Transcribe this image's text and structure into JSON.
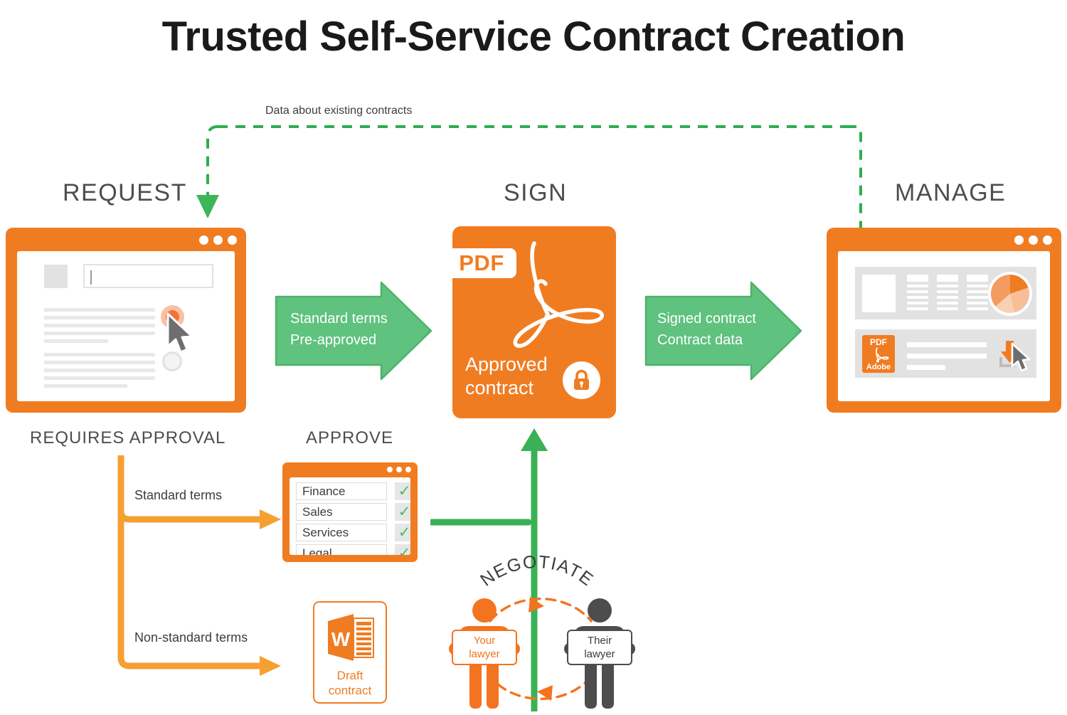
{
  "title": "Trusted Self-Service Contract Creation",
  "colors": {
    "orange": "#F07C22",
    "orange_light": "#F4733A",
    "green": "#54BE72",
    "green_arrow": "#5FC27E",
    "dark_gray": "#4D4D4D",
    "light_gray": "#E2E2E2"
  },
  "feedback_loop": {
    "label": "Data about existing contracts"
  },
  "stages": {
    "request": {
      "label": "REQUEST"
    },
    "sign": {
      "label": "SIGN"
    },
    "manage": {
      "label": "MANAGE"
    },
    "approve": {
      "label": "APPROVE"
    },
    "requires_approval": {
      "label": "REQUIRES APPROVAL"
    }
  },
  "arrows": {
    "request_to_sign": {
      "line1": "Standard terms",
      "line2": "Pre-approved"
    },
    "sign_to_manage": {
      "line1": "Signed contract",
      "line2": "Contract data"
    },
    "branch_standard": {
      "label": "Standard terms"
    },
    "branch_nonstandard": {
      "label": "Non-standard terms"
    }
  },
  "sign_card": {
    "badge": "PDF",
    "caption_line1": "Approved",
    "caption_line2": "contract",
    "lock_icon": "lock-icon"
  },
  "approve_panel": {
    "items": [
      {
        "name": "Finance",
        "checked": true
      },
      {
        "name": "Sales",
        "checked": true
      },
      {
        "name": "Services",
        "checked": true
      },
      {
        "name": "Legal",
        "checked": true
      }
    ],
    "check_glyph": "✓"
  },
  "draft_contract": {
    "icon": "word-document-icon",
    "icon_letter": "W",
    "caption_line1": "Draft",
    "caption_line2": "contract"
  },
  "negotiate": {
    "label": "NEGOTIATE",
    "your_lawyer": {
      "line1": "Your",
      "line2": "lawyer"
    },
    "their_lawyer": {
      "line1": "Their",
      "line2": "lawyer"
    }
  },
  "manage_window": {
    "pdf_icon": {
      "top_text": "PDF",
      "bottom_text": "Adobe"
    },
    "pie_chart": {
      "slices": [
        {
          "label": "slice-1",
          "color": "#F07C22",
          "percent": 16
        },
        {
          "label": "slice-2",
          "color": "#F49B60",
          "percent": 34
        },
        {
          "label": "slice-3",
          "color": "#FAD0B4",
          "percent": 24
        },
        {
          "label": "slice-4",
          "color": "#F8BE98",
          "percent": 26
        }
      ]
    },
    "download_icon": "download-icon",
    "cursor_icon": "cursor-icon"
  },
  "chart_data": {
    "type": "pie",
    "title": "",
    "categories": [
      "slice-1",
      "slice-2",
      "slice-3",
      "slice-4"
    ],
    "values": [
      16,
      34,
      24,
      26
    ],
    "colors": [
      "#F07C22",
      "#F49B60",
      "#FAD0B4",
      "#F8BE98"
    ],
    "legend": "none",
    "grid": false
  }
}
